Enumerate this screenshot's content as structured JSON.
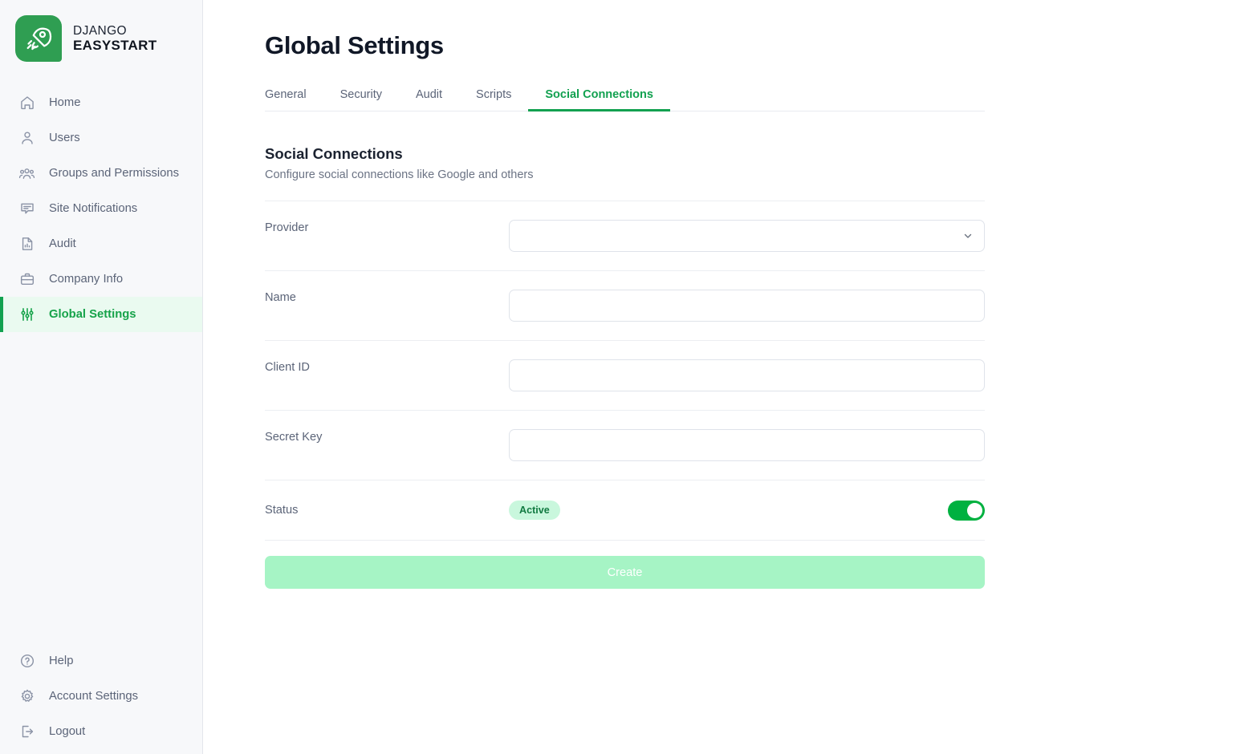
{
  "brand": {
    "logo_icon": "rocket-icon",
    "line1": "DJANGO",
    "line2": "EASYSTART"
  },
  "sidebar": {
    "main_items": [
      {
        "label": "Home",
        "icon": "home-icon",
        "active": false
      },
      {
        "label": "Users",
        "icon": "users-icon",
        "active": false
      },
      {
        "label": "Groups and Permissions",
        "icon": "group-icon",
        "active": false
      },
      {
        "label": "Site Notifications",
        "icon": "comment-icon",
        "active": false
      },
      {
        "label": "Audit",
        "icon": "document-chart-icon",
        "active": false
      },
      {
        "label": "Company Info",
        "icon": "briefcase-icon",
        "active": false
      },
      {
        "label": "Global Settings",
        "icon": "sliders-icon",
        "active": true
      }
    ],
    "bottom_items": [
      {
        "label": "Help",
        "icon": "question-circle-icon"
      },
      {
        "label": "Account Settings",
        "icon": "gear-icon"
      },
      {
        "label": "Logout",
        "icon": "logout-icon"
      }
    ]
  },
  "header": {
    "title": "Global Settings"
  },
  "tabs": [
    {
      "label": "General",
      "active": false
    },
    {
      "label": "Security",
      "active": false
    },
    {
      "label": "Audit",
      "active": false
    },
    {
      "label": "Scripts",
      "active": false
    },
    {
      "label": "Social Connections",
      "active": true
    }
  ],
  "section": {
    "title": "Social Connections",
    "subtitle": "Configure social connections like Google and others"
  },
  "form": {
    "provider": {
      "label": "Provider",
      "value": "",
      "placeholder": "",
      "chevron_icon": "chevron-down-icon"
    },
    "name": {
      "label": "Name",
      "value": "",
      "placeholder": ""
    },
    "client_id": {
      "label": "Client ID",
      "value": "",
      "placeholder": ""
    },
    "secret_key": {
      "label": "Secret Key",
      "value": "",
      "placeholder": ""
    },
    "status": {
      "label": "Status",
      "badge": "Active",
      "toggle_on": true
    },
    "submit_label": "Create"
  },
  "colors": {
    "accent_green": "#12a150",
    "brand_green": "#2f9e52",
    "toggle_green": "#00b140",
    "badge_bg": "#c9f7dd",
    "badge_text": "#117a41",
    "button_disabled": "#a6f4c5",
    "sidebar_bg": "#f7f8fa",
    "label_text": "#5b6478"
  }
}
